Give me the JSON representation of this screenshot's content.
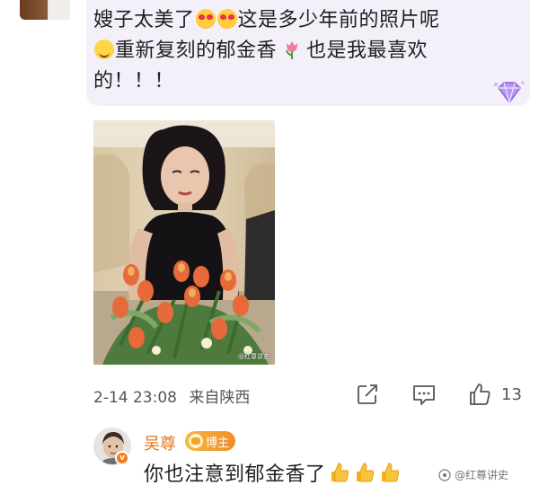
{
  "comment": {
    "line1_a": "嫂子太美了",
    "line1_b": "这是多少年前的照片呢",
    "line2_a": "重新复刻的郁金香",
    "line2_b": "也是我最喜欢",
    "line3": "的！！！"
  },
  "photo": {
    "watermark": "@红尊讲史"
  },
  "meta": {
    "timestamp": "2-14 23:08",
    "location": "来自陕西"
  },
  "actions": {
    "like_count": "13"
  },
  "reply": {
    "author": "吴尊",
    "author_tag": "博主",
    "text": "你也注意到郁金香了",
    "verified_mark": "v"
  },
  "brand": {
    "watermark": "@红尊讲史"
  },
  "colors": {
    "bubble": "#f4f0fa",
    "author_name": "#e07a1f",
    "host_tag": "#f18d2a",
    "thumbs": "#f5b21c"
  },
  "icons": {
    "share": "share-icon",
    "reply": "comment-icon",
    "like": "thumbs-up-icon",
    "vip": "diamond-badge-icon"
  }
}
